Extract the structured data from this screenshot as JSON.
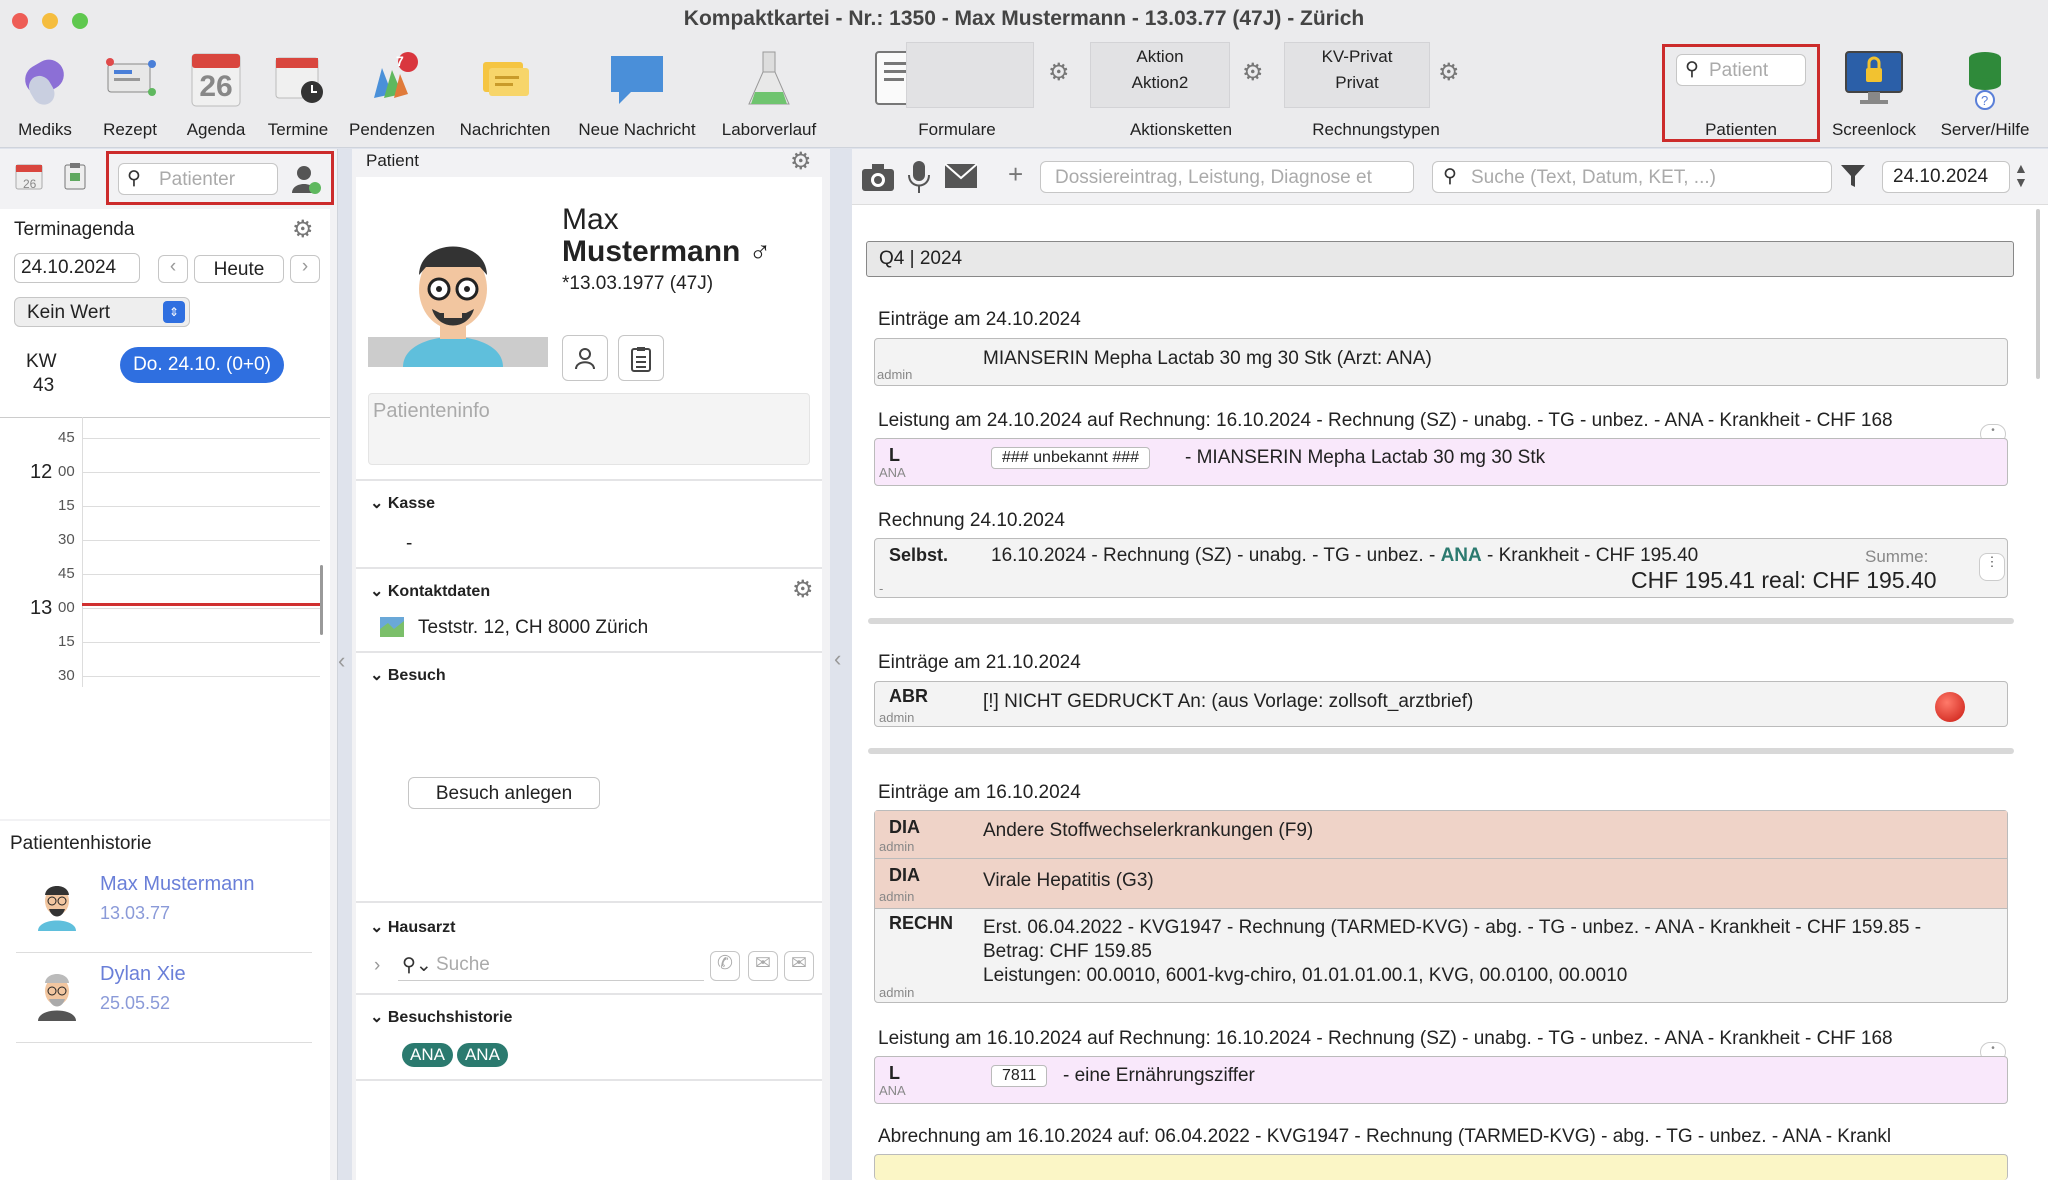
{
  "window": {
    "title": "Kompaktkartei - Nr.: 1350 - Max Mustermann - 13.03.77 (47J) - Zürich"
  },
  "toolbar": {
    "mediks": "Mediks",
    "rezept": "Rezept",
    "agenda": "Agenda",
    "agenda_day": "26",
    "termine": "Termine",
    "pendenzen": "Pendenzen",
    "pendenzen_badge": "7",
    "nachrichten": "Nachrichten",
    "neue_nachricht": "Neue Nachricht",
    "laborverlauf": "Laborverlauf",
    "formulare": "Formulare",
    "aktion1": "Aktion",
    "aktion2": "Aktion2",
    "aktionsketten": "Aktionsketten",
    "kv_privat": "KV-Privat",
    "privat": "Privat",
    "rechnungstypen": "Rechnungstypen",
    "patient_placeholder": "Patient",
    "patienten": "Patienten",
    "screenlock": "Screenlock",
    "server_hilfe": "Server/Hilfe"
  },
  "left": {
    "search_placeholder": "Patienter",
    "mini_day": "26",
    "terminagenda": "Terminagenda",
    "date": "24.10.2024",
    "heute": "Heute",
    "kein_wert": "Kein Wert",
    "kw_label": "KW",
    "kw_num": "43",
    "day_chip": "Do. 24.10. (0+0)",
    "hours": [
      {
        "h": "",
        "m": "45"
      },
      {
        "h": "12",
        "m": "00"
      },
      {
        "h": "",
        "m": "15"
      },
      {
        "h": "",
        "m": "30"
      },
      {
        "h": "",
        "m": "45"
      },
      {
        "h": "13",
        "m": "00"
      },
      {
        "h": "",
        "m": "15"
      },
      {
        "h": "",
        "m": "30"
      }
    ],
    "historie_title": "Patientenhistorie",
    "historie": [
      {
        "name": "Max Mustermann",
        "date": "13.03.77"
      },
      {
        "name": "Dylan Xie",
        "date": "25.05.52"
      }
    ]
  },
  "patient": {
    "header": "Patient",
    "first": "Max",
    "last": "Mustermann ♂",
    "dob": "*13.03.1977 (47J)",
    "info_placeholder": "Patienteninfo",
    "kasse": "Kasse",
    "kasse_val": "-",
    "kontakt": "Kontaktdaten",
    "address": "Teststr. 12, CH 8000 Zürich",
    "besuch": "Besuch",
    "besuch_btn": "Besuch anlegen",
    "hausarzt": "Hausarzt",
    "hausarzt_search": "Suche",
    "besuchshistorie": "Besuchshistorie",
    "visits": [
      "ANA",
      "ANA"
    ]
  },
  "journal": {
    "entry_placeholder": "Dossiereintrag, Leistung, Diagnose et",
    "search_placeholder": "Suche (Text, Datum, KET, ...)",
    "date": "24.10.2024",
    "quarter": "Q4 | 2024",
    "h1": "Einträge am 24.10.2024",
    "e1_text": "MIANSERIN Mepha Lactab 30 mg 30 Stk (Arzt: ANA)",
    "admin": "admin",
    "h2": "Leistung am 24.10.2024 auf Rechnung: 16.10.2024 - Rechnung (SZ) - unabg. - TG - unbez. - ANA - Krankheit - CHF 168",
    "l_tag": "L",
    "l_sub": "ANA",
    "l1_code": "### unbekannt ###",
    "l1_text": "- MIANSERIN Mepha Lactab 30 mg 30 Stk",
    "h3": "Rechnung 24.10.2024",
    "r_tag": "Selbst.",
    "r_text_a": "16.10.2024 - Rechnung (SZ) - unabg. - TG - unbez. -",
    "r_ana": "ANA",
    "r_text_b": "- Krankheit - CHF 195.40",
    "r_summe": "Summe:",
    "r_total": "CHF 195.41 real: CHF 195.40",
    "r_dash": "-",
    "h4": "Einträge am 21.10.2024",
    "abr_tag": "ABR",
    "abr_text": "[!] NICHT GEDRUCKT An:   (aus Vorlage: zollsoft_arztbrief)",
    "h5": "Einträge am 16.10.2024",
    "dia_tag": "DIA",
    "dia1": "Andere Stoffwechselerkrankungen (F9)",
    "dia2": "Virale Hepatitis (G3)",
    "rechn_tag": "RECHN",
    "rechn1": "Erst. 06.04.2022 - KVG1947 - Rechnung (TARMED-KVG) - abg. - TG - unbez. - ANA - Krankheit - CHF 159.85 -",
    "rechn2": "Betrag: CHF 159.85",
    "rechn3": "Leistungen: 00.0010, 6001-kvg-chiro, 01.01.01.00.1, KVG, 00.0100, 00.0010",
    "h6": "Leistung am 16.10.2024 auf Rechnung: 16.10.2024 - Rechnung (SZ) - unabg. - TG - unbez. - ANA - Krankheit - CHF 168",
    "l2_code": "7811",
    "l2_text": "- eine Ernährungsziffer",
    "h7": "Abrechnung am 16.10.2024 auf: 06.04.2022 - KVG1947 - Rechnung (TARMED-KVG) - abg. - TG - unbez. - ANA - Krankl"
  },
  "colors": {
    "accent": "#2f6fe0",
    "red": "#cc2b2b",
    "dia_bg": "#efd3c8",
    "leistung_bg": "#f9e8fb",
    "pill": "#2b7a6f"
  }
}
